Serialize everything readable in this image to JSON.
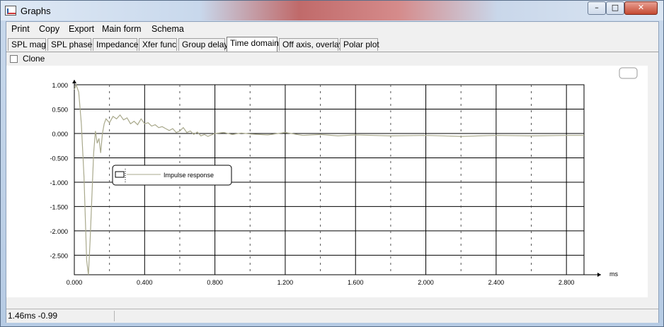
{
  "window": {
    "title": "Graphs",
    "minimize": "–",
    "maximize": "□",
    "close": "✕"
  },
  "menu": [
    "Print",
    "Copy",
    "Export",
    "Main form",
    "Schema"
  ],
  "tabs": [
    "SPL mag",
    "SPL phase",
    "Impedance",
    "Xfer func",
    "Group delay",
    "Time domain",
    "Off axis, overlay",
    "Polar plot"
  ],
  "active_tab": "Time domain",
  "clone": {
    "label": "Clone",
    "checked": false
  },
  "status": {
    "readout": "1.46ms -0.99"
  },
  "chart_data": {
    "type": "line",
    "xunit": "ms",
    "xlim": [
      0.0,
      2.9
    ],
    "ylim": [
      -2.9,
      1.0
    ],
    "xticks": [
      "0.000",
      "0.400",
      "0.800",
      "1.200",
      "1.600",
      "2.000",
      "2.400",
      "2.800"
    ],
    "yticks": [
      "1.000",
      "0.500",
      "0.000",
      "-0.500",
      "-1.000",
      "-1.500",
      "-2.000",
      "-2.500"
    ],
    "grid": true,
    "legend": {
      "entries": [
        "Impulse response"
      ],
      "placement": "left"
    },
    "series": [
      {
        "name": "Impulse response",
        "color": "#a9a98c",
        "x": [
          0.0,
          0.01,
          0.025,
          0.04,
          0.055,
          0.07,
          0.08,
          0.09,
          0.1,
          0.11,
          0.12,
          0.13,
          0.14,
          0.15,
          0.16,
          0.17,
          0.18,
          0.2,
          0.22,
          0.24,
          0.26,
          0.28,
          0.3,
          0.32,
          0.34,
          0.36,
          0.38,
          0.4,
          0.42,
          0.44,
          0.46,
          0.48,
          0.5,
          0.52,
          0.54,
          0.56,
          0.58,
          0.6,
          0.62,
          0.64,
          0.66,
          0.68,
          0.7,
          0.72,
          0.74,
          0.76,
          0.78,
          0.8,
          0.85,
          0.9,
          0.95,
          1.0,
          1.1,
          1.2,
          1.3,
          1.4,
          1.5,
          1.6,
          1.8,
          2.0,
          2.2,
          2.4,
          2.6,
          2.8,
          2.9
        ],
        "y": [
          0.9,
          1.0,
          0.85,
          0.2,
          -0.9,
          -2.6,
          -2.9,
          -2.2,
          -1.3,
          -0.4,
          0.05,
          -0.2,
          -0.1,
          -0.4,
          0.0,
          0.2,
          0.3,
          0.22,
          0.35,
          0.3,
          0.38,
          0.28,
          0.32,
          0.2,
          0.25,
          0.18,
          0.3,
          0.2,
          0.22,
          0.15,
          0.18,
          0.12,
          0.14,
          0.1,
          0.06,
          0.1,
          0.02,
          0.05,
          0.12,
          0.02,
          0.05,
          -0.02,
          0.03,
          -0.05,
          -0.02,
          -0.06,
          -0.03,
          0.0,
          0.02,
          -0.02,
          0.01,
          -0.01,
          -0.03,
          0.02,
          -0.04,
          -0.02,
          -0.05,
          -0.03,
          -0.05,
          -0.04,
          -0.06,
          -0.04,
          -0.05,
          -0.04,
          -0.04
        ]
      }
    ]
  }
}
